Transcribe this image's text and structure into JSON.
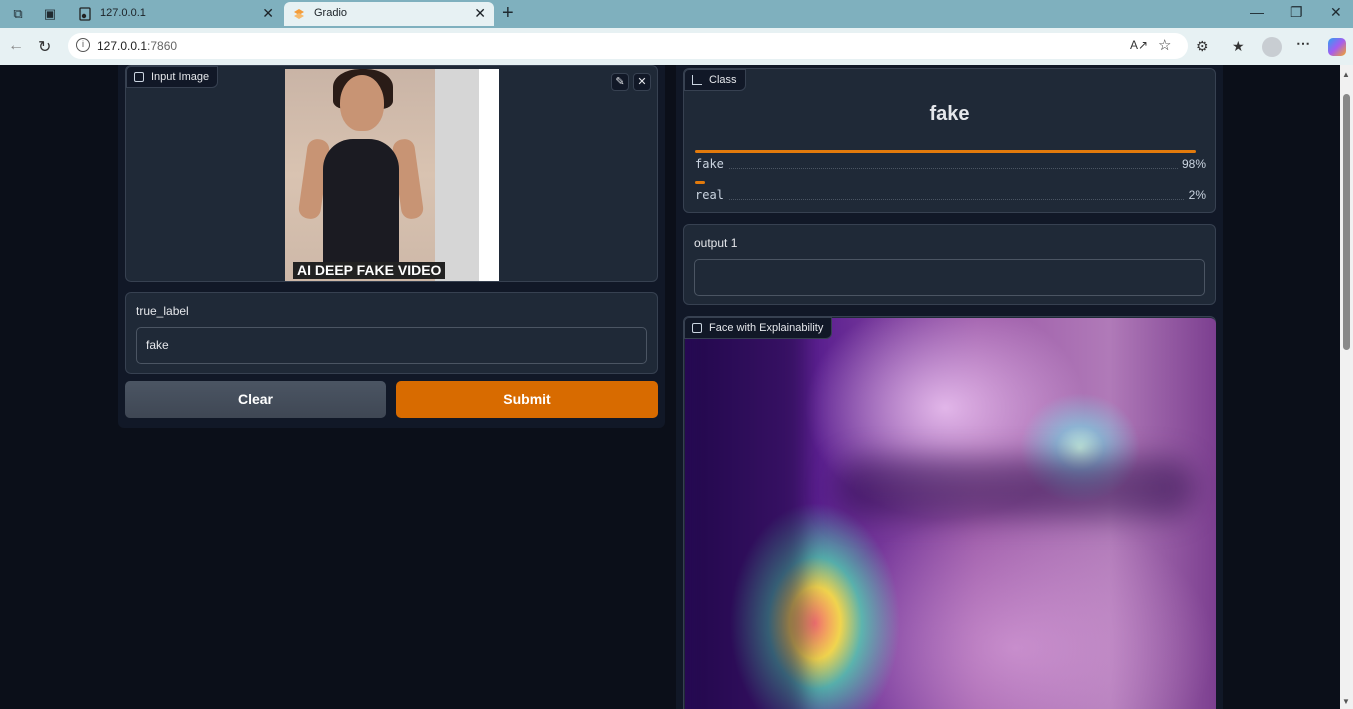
{
  "browser": {
    "tabs": [
      {
        "title": "127.0.0.1",
        "active": false
      },
      {
        "title": "Gradio",
        "active": true
      }
    ],
    "url_host": "127.0.0.1",
    "url_port": ":7860",
    "icons": [
      "workspaces-icon",
      "tab-actions-icon",
      "back-icon",
      "refresh-icon",
      "read-aloud-icon",
      "favorite-star-icon",
      "extensions-icon",
      "favorites-icon",
      "profile-icon",
      "more-icon",
      "copilot-icon"
    ]
  },
  "input_image": {
    "label": "Input Image",
    "caption": "AI DEEP FAKE VIDEO"
  },
  "true_label": {
    "label": "true_label",
    "value": "fake"
  },
  "buttons": {
    "clear": "Clear",
    "submit": "Submit"
  },
  "class_output": {
    "label": "Class",
    "prediction": "fake",
    "confidences": [
      {
        "label": "fake",
        "value": 0.98,
        "pct": "98%"
      },
      {
        "label": "real",
        "value": 0.02,
        "pct": "2%"
      }
    ]
  },
  "output1": {
    "label": "output 1",
    "value": ""
  },
  "explain_image": {
    "label": "Face with Explainability"
  },
  "colors": {
    "accent": "#d86b00",
    "bar": "#e27a0c",
    "background": "#0b0f19",
    "panel": "#1f2937"
  }
}
